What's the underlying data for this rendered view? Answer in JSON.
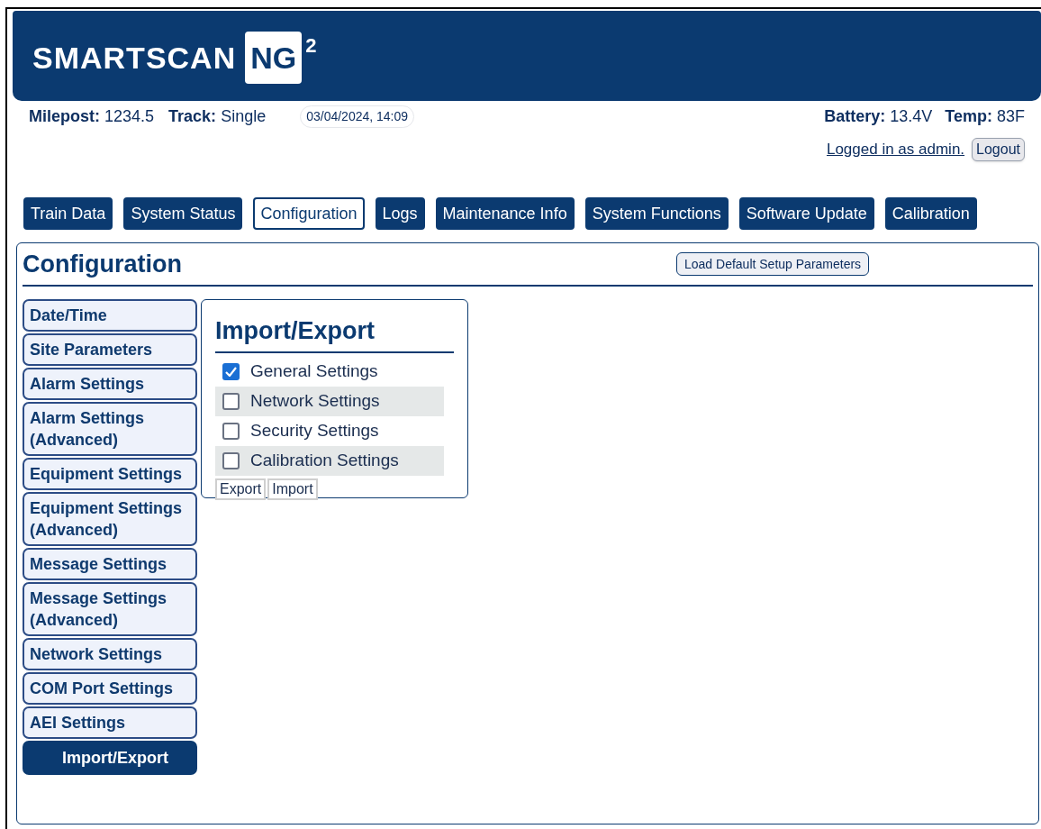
{
  "logo": {
    "wordmark": "SMARTSCAN",
    "badge": "NG",
    "superscript": "2"
  },
  "info": [
    {
      "label": "Milepost:",
      "value": "1234.5"
    },
    {
      "label": "Track:",
      "value": "Single"
    }
  ],
  "datetime": "03/04/2024, 14:09",
  "readings": [
    {
      "label": "Battery:",
      "value": "13.4V"
    },
    {
      "label": "Temp:",
      "value": "83F"
    }
  ],
  "login": {
    "text": "Logged in as admin.",
    "button": "Logout"
  },
  "tabs": [
    {
      "label": "Train Data",
      "selected": false
    },
    {
      "label": "System Status",
      "selected": false
    },
    {
      "label": "Configuration",
      "selected": true
    },
    {
      "label": "Logs",
      "selected": false
    },
    {
      "label": "Maintenance Info",
      "selected": false
    },
    {
      "label": "System Functions",
      "selected": false
    },
    {
      "label": "Software Update",
      "selected": false
    },
    {
      "label": "Calibration",
      "selected": false
    }
  ],
  "panel": {
    "title": "Configuration",
    "button": "Load Default Setup Parameters"
  },
  "sidebar": {
    "items": [
      {
        "label": "Date/Time",
        "selected": false
      },
      {
        "label": "Site Parameters",
        "selected": false
      },
      {
        "label": "Alarm Settings",
        "selected": false
      },
      {
        "label": "Alarm Settings (Advanced)",
        "selected": false
      },
      {
        "label": "Equipment Settings",
        "selected": false
      },
      {
        "label": "Equipment Settings (Advanced)",
        "selected": false
      },
      {
        "label": "Message Settings",
        "selected": false
      },
      {
        "label": "Message Settings (Advanced)",
        "selected": false
      },
      {
        "label": "Network Settings",
        "selected": false
      },
      {
        "label": "COM Port Settings",
        "selected": false
      },
      {
        "label": "AEI Settings",
        "selected": false
      },
      {
        "label": "Import/Export",
        "selected": true
      }
    ]
  },
  "card": {
    "title": "Import/Export",
    "options": [
      {
        "label": "General Settings",
        "checked": true
      },
      {
        "label": "Network Settings",
        "checked": false
      },
      {
        "label": "Security Settings",
        "checked": false
      },
      {
        "label": "Calibration Settings",
        "checked": false
      }
    ],
    "buttons": [
      "Export",
      "Import"
    ]
  }
}
